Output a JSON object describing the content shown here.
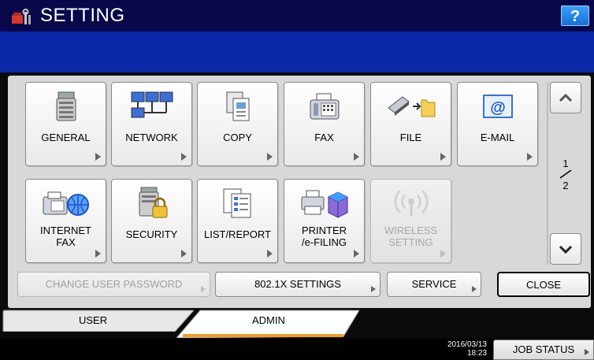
{
  "header": {
    "title": "SETTING",
    "help_label": "?"
  },
  "tiles": [
    {
      "label": "GENERAL",
      "icon": "copier-icon",
      "enabled": true
    },
    {
      "label": "NETWORK",
      "icon": "network-icon",
      "enabled": true
    },
    {
      "label": "COPY",
      "icon": "copy-icon",
      "enabled": true
    },
    {
      "label": "FAX",
      "icon": "fax-icon",
      "enabled": true
    },
    {
      "label": "FILE",
      "icon": "file-icon",
      "enabled": true
    },
    {
      "label": "E-MAIL",
      "icon": "email-icon",
      "enabled": true
    },
    {
      "label": "INTERNET\nFAX",
      "icon": "internet-fax-icon",
      "enabled": true
    },
    {
      "label": "SECURITY",
      "icon": "security-icon",
      "enabled": true
    },
    {
      "label": "LIST/REPORT",
      "icon": "list-report-icon",
      "enabled": true
    },
    {
      "label": "PRINTER\n/e-FILING",
      "icon": "printer-efiling-icon",
      "enabled": true
    },
    {
      "label": "WIRELESS\nSETTING",
      "icon": "wireless-icon",
      "enabled": false
    }
  ],
  "pager": {
    "current": "1",
    "total": "2"
  },
  "actions": {
    "change_password": "CHANGE USER PASSWORD",
    "dot1x": "802.1X SETTINGS",
    "service": "SERVICE",
    "close": "CLOSE"
  },
  "tabs": {
    "user": "USER",
    "admin": "ADMIN",
    "active": "ADMIN"
  },
  "status": {
    "date": "2016/03/13",
    "time": "18:23",
    "job_status": "JOB STATUS"
  },
  "colors": {
    "title_bar": "#07074a",
    "blue_band": "#0a28a8",
    "help": "#1f86f0",
    "tab_active_accent": "#f0a020"
  }
}
